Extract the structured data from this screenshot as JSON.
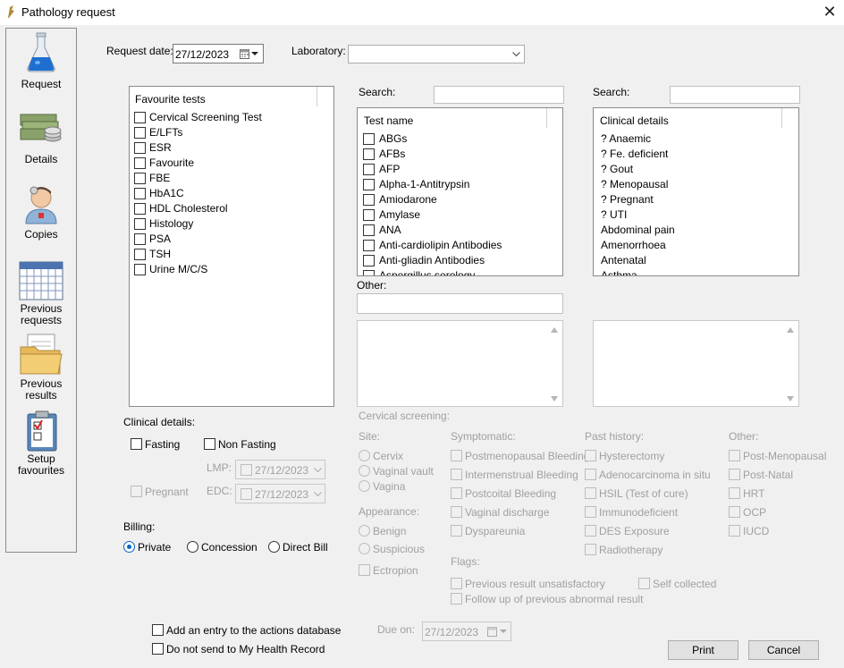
{
  "window": {
    "title": "Pathology request",
    "close": "✕"
  },
  "nav": [
    {
      "label": "Request",
      "icon": "flask-icon"
    },
    {
      "label": "Details",
      "icon": "money-icon"
    },
    {
      "label": "Copies",
      "icon": "doctor-icon"
    },
    {
      "label": "Previous requests",
      "icon": "calendar-icon"
    },
    {
      "label": "Previous results",
      "icon": "folder-icon"
    },
    {
      "label": "Setup favourites",
      "icon": "clipboard-icon"
    }
  ],
  "request_date": {
    "label": "Request date:",
    "value": "27/12/2023"
  },
  "laboratory": {
    "label": "Laboratory:",
    "value": ""
  },
  "favourites": {
    "header": "Favourite tests",
    "items": [
      "Cervical Screening Test",
      "E/LFTs",
      "ESR",
      "Favourite",
      "FBE",
      "HbA1C",
      "HDL Cholesterol",
      "Histology",
      "PSA",
      "TSH",
      "Urine M/C/S"
    ]
  },
  "tests": {
    "search_label": "Search:",
    "search_value": "",
    "header": "Test name",
    "items": [
      "ABGs",
      "AFBs",
      "AFP",
      "Alpha-1-Antitrypsin",
      "Amiodarone",
      "Amylase",
      "ANA",
      "Anti-cardiolipin Antibodies",
      "Anti-gliadin Antibodies",
      "Aspergillus serology"
    ]
  },
  "clinical_list": {
    "search_label": "Search:",
    "search_value": "",
    "header": "Clinical details",
    "items": [
      "? Anaemic",
      "? Fe. deficient",
      "? Gout",
      "? Menopausal",
      "? Pregnant",
      "? UTI",
      "Abdominal pain",
      "Amenorrhoea",
      "Antenatal",
      "Asthma"
    ]
  },
  "other": {
    "label": "Other:",
    "value": ""
  },
  "clinical_details": {
    "label": "Clinical details:",
    "fasting": "Fasting",
    "non_fasting": "Non Fasting",
    "pregnant": "Pregnant",
    "lmp_label": "LMP:",
    "lmp_value": "27/12/2023",
    "edc_label": "EDC:",
    "edc_value": "27/12/2023"
  },
  "billing": {
    "label": "Billing:",
    "options": [
      "Private",
      "Concession",
      "Direct Bill"
    ],
    "selected": "Private"
  },
  "cervical": {
    "title": "Cervical screening:",
    "site_label": "Site:",
    "site": [
      "Cervix",
      "Vaginal vault",
      "Vagina"
    ],
    "appearance_label": "Appearance:",
    "appearance": [
      "Benign",
      "Suspicious"
    ],
    "ectropion": "Ectropion",
    "symptomatic_label": "Symptomatic:",
    "symptomatic": [
      "Postmenopausal Bleeding",
      "Intermenstrual Bleeding",
      "Postcoital Bleeding",
      "Vaginal discharge",
      "Dyspareunia"
    ],
    "past_label": "Past history:",
    "past": [
      "Hysterectomy",
      "Adenocarcinoma in situ",
      "HSIL (Test of cure)",
      "Immunodeficient",
      "DES Exposure",
      "Radiotherapy"
    ],
    "other_label": "Other:",
    "other": [
      "Post-Menopausal",
      "Post-Natal",
      "HRT",
      "OCP",
      "IUCD"
    ],
    "flags_label": "Flags:",
    "flags": [
      "Previous result unsatisfactory",
      "Follow up of previous abnormal result"
    ],
    "self_collected": "Self collected"
  },
  "footer": {
    "actions_db": "Add an entry to the actions database",
    "no_mhr": "Do not send to My Health Record",
    "due_label": "Due on:",
    "due_value": "27/12/2023",
    "print": "Print",
    "cancel": "Cancel"
  }
}
